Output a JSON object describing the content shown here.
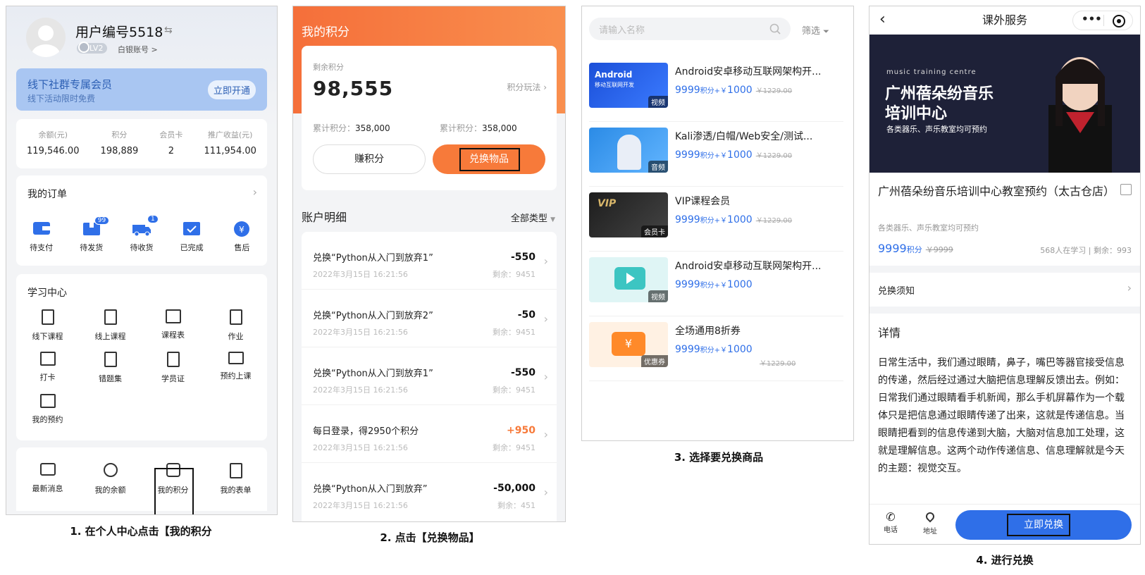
{
  "s1": {
    "username": "用户编号5518",
    "level": "LV2",
    "account_type": "白银账号 >",
    "member_title": "线下社群专属会员",
    "member_sub": "线下活动限时免费",
    "member_btn": "立即开通",
    "stats": [
      {
        "label": "余额(元)",
        "value": "119,546.00"
      },
      {
        "label": "积分",
        "value": "198,889"
      },
      {
        "label": "会员卡",
        "value": "2"
      },
      {
        "label": "推广收益(元)",
        "value": "111,954.00"
      }
    ],
    "orders_title": "我的订单",
    "orders": [
      {
        "label": "待支付",
        "badge": ""
      },
      {
        "label": "待发货",
        "badge": "99"
      },
      {
        "label": "待收货",
        "badge": "1"
      },
      {
        "label": "已完成",
        "badge": ""
      },
      {
        "label": "售后",
        "badge": ""
      }
    ],
    "study_title": "学习中心",
    "study": [
      "线下课程",
      "线上课程",
      "课程表",
      "作业",
      "打卡",
      "错题集",
      "学员证",
      "预约上课",
      "我的预约"
    ],
    "bottom": [
      "最新消息",
      "我的余额",
      "我的积分",
      "我的表单"
    ],
    "caption": "1. 在个人中心点击【我的积分"
  },
  "s2": {
    "title": "我的积分",
    "remain_label": "剩余积分",
    "remain_value": "98,555",
    "rules_link": "积分玩法",
    "total1_label": "累计积分：",
    "total1_value": "358,000",
    "total2_label": "累计积分：",
    "total2_value": "358,000",
    "earn_btn": "赚积分",
    "exchange_btn": "兑换物品",
    "detail_title": "账户明细",
    "filter": "全部类型",
    "records": [
      {
        "title": "兑换“Python从入门到放弃1”",
        "time": "2022年3月15日 16:21:56",
        "amount": "-550",
        "remain": "剩余：9451",
        "positive": false
      },
      {
        "title": "兑换“Python从入门到放弃2”",
        "time": "2022年3月15日 16:21:56",
        "amount": "-50",
        "remain": "剩余：9451",
        "positive": false
      },
      {
        "title": "兑换“Python从入门到放弃1”",
        "time": "2022年3月15日 16:21:56",
        "amount": "-550",
        "remain": "剩余：9451",
        "positive": false
      },
      {
        "title": "每日登录，得2950个积分",
        "time": "2022年3月15日 16:21:56",
        "amount": "+950",
        "remain": "剩余：9451",
        "positive": true
      },
      {
        "title": "兑换“Python从入门到放弃”",
        "time": "2022年3月15日 16:21:56",
        "amount": "-50,000",
        "remain": "剩余：451",
        "positive": false
      }
    ],
    "caption": "2. 点击【兑换物品】"
  },
  "s3": {
    "search_placeholder": "请输入名称",
    "filter": "筛选",
    "items": [
      {
        "title": "Android安卓移动互联网架构开...",
        "points": "9999",
        "unit": "积分+￥",
        "cash": "1000",
        "old": "￥1229.00",
        "tag": "视频",
        "thumb": "android",
        "thumb_text": "Android",
        "thumb_sub": "移动互联网开发"
      },
      {
        "title": "Kali渗透/白帽/Web安全/测试...",
        "points": "9999",
        "unit": "积分+￥",
        "cash": "1000",
        "old": "￥1229.00",
        "tag": "音频",
        "thumb": "kali",
        "thumb_text": "",
        "thumb_sub": ""
      },
      {
        "title": "VIP课程会员",
        "points": "9999",
        "unit": "积分+￥",
        "cash": "1000",
        "old": "￥1229.00",
        "tag": "会员卡",
        "thumb": "vip",
        "thumb_text": "VIP",
        "thumb_sub": ""
      },
      {
        "title": "Android安卓移动互联网架构开...",
        "points": "9999",
        "unit": "积分+￥",
        "cash": "1000",
        "old": "",
        "tag": "视频",
        "thumb": "video",
        "thumb_text": "",
        "thumb_sub": ""
      },
      {
        "title": "全场通用8折券",
        "points": "9999",
        "unit": "积分+￥",
        "cash": "1000",
        "old": "￥1229.00",
        "tag": "优惠券",
        "thumb": "coupon",
        "thumb_text": "¥",
        "thumb_sub": ""
      }
    ],
    "caption": "3. 选择要兑换商品"
  },
  "s4": {
    "title": "课外服务",
    "banner_small": "music training centre",
    "banner_line1": "广州蓓朵纷音乐",
    "banner_line2": "培训中心",
    "banner_sub": "各类器乐、声乐教室均可预约",
    "product_title": "广州蓓朵纷音乐培训中心教室预约（太古仓店）",
    "product_sub": "各类器乐、声乐教室均可预约",
    "price": "9999",
    "price_unit": "积分",
    "old_price": "￥9999",
    "learners": "568人在学习",
    "stock": "剩余：993",
    "notice": "兑换须知",
    "detail_title": "详情",
    "detail_text": "日常生活中，我们通过眼睛，鼻子，嘴巴等器官接受信息的传递，然后经过通过大脑把信息理解反馈出去。例如：日常我们通过眼睛看手机新闻，那么手机屏幕作为一个载体只是把信息通过眼睛传递了出来，这就是传递信息。当眼睛把看到的信息传递到大脑，大脑对信息加工处理，这就是理解信息。这两个动作传递信息、信息理解就是今天的主题：视觉交互。",
    "phone_label": "电话",
    "address_label": "地址",
    "buy_btn": "立即兑换",
    "caption": "4. 进行兑换"
  },
  "colors": {
    "orange": "#f77a3a",
    "blue": "#2f6fe8",
    "member_bg": "#a9c6f2"
  }
}
